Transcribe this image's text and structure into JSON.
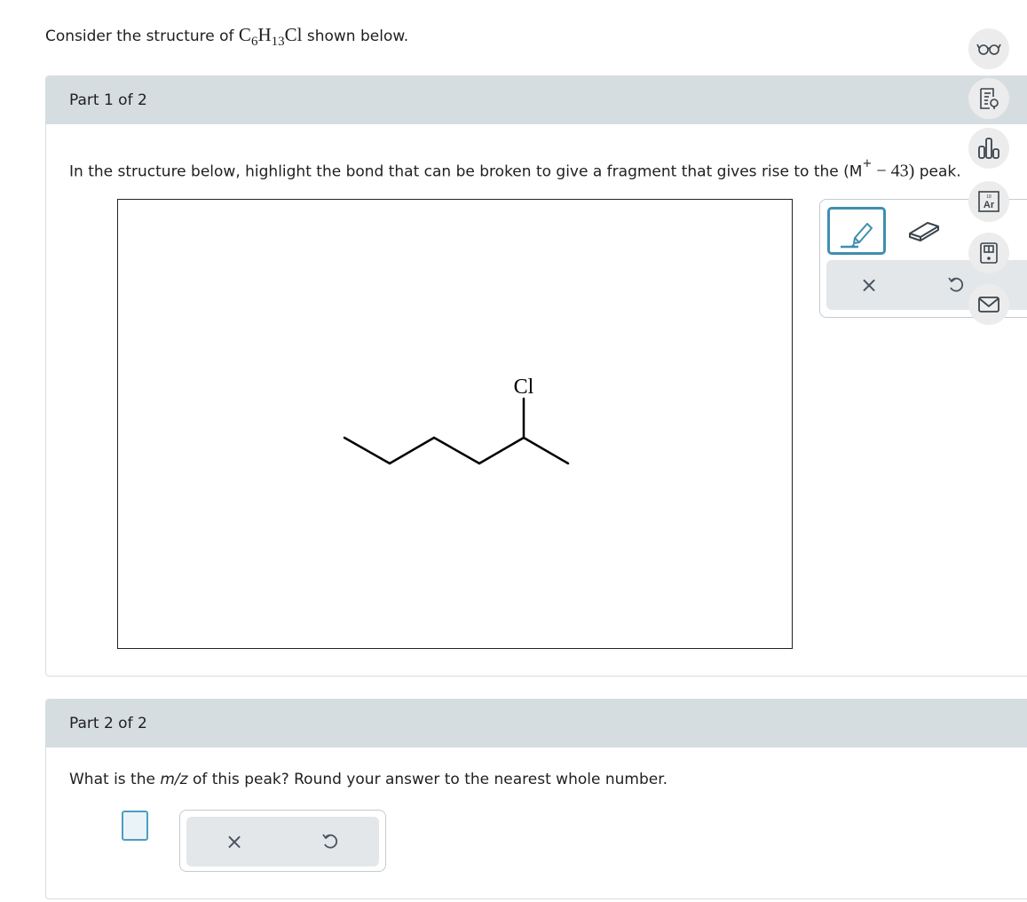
{
  "intro": {
    "prefix": "Consider the structure of ",
    "formula_c": "C",
    "formula_c_sub": "6",
    "formula_h": "H",
    "formula_h_sub": "13",
    "formula_cl": "Cl",
    "suffix": " shown below."
  },
  "part1": {
    "header": "Part 1 of 2",
    "prompt_prefix": "In the structure below, highlight the bond that can be broken to give a fragment that gives rise to the (M",
    "prompt_sup": "+",
    "prompt_minus": " − ",
    "prompt_number": "43)",
    "prompt_suffix": " peak.",
    "molecule_label": "Cl",
    "tools": {
      "highlight_icon": "highlighter-icon",
      "eraser_icon": "eraser-icon",
      "clear_label": "×",
      "undo_label": "↺"
    }
  },
  "part2": {
    "header": "Part 2 of 2",
    "prompt_prefix": "What is the ",
    "prompt_italic": "m/z",
    "prompt_suffix": " of this peak? Round your answer to the nearest whole number.",
    "answer_value": "",
    "clear_label": "×",
    "undo_label": "↺"
  },
  "side_toolbar": {
    "items": [
      "glasses-icon",
      "worksheet-icon",
      "bar-chart-icon",
      "periodic-table-icon",
      "calculator-book-icon",
      "mail-icon"
    ],
    "periodic_label": "Ar",
    "periodic_number": "18"
  },
  "colors": {
    "header_bg": "#d5dde1",
    "accent": "#3f8fb0",
    "action_bg": "#e3e7ea"
  }
}
